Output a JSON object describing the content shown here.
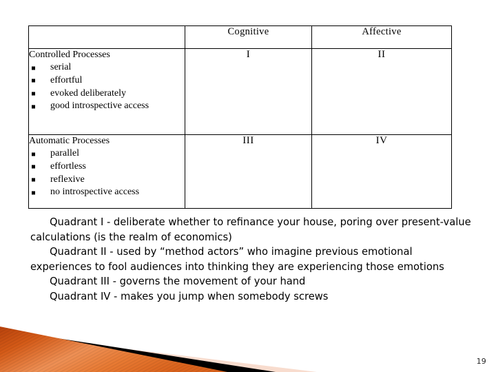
{
  "slide": {
    "page_number": "19"
  },
  "table": {
    "headers": {
      "blank": "",
      "cognitive": "Cognitive",
      "affective": "Affective"
    },
    "rows": [
      {
        "title": "Controlled Processes",
        "bullets": [
          "serial",
          "effortful",
          "evoked deliberately",
          "good introspective access"
        ],
        "cognitive": "I",
        "affective": "II"
      },
      {
        "title": "Automatic Processes",
        "bullets": [
          "parallel",
          "effortless",
          "reflexive",
          "no introspective access"
        ],
        "cognitive": "III",
        "affective": "IV"
      }
    ]
  },
  "body": {
    "paragraphs": [
      "Quadrant I - deliberate whether to refinance your house, poring over present-value calculations (is the realm of economics)",
      "Quadrant II - used by “method actors” who imagine previous emotional experiences to fool audiences into thinking they are experiencing those emotions",
      "Quadrant III - governs the movement of your hand",
      "Quadrant IV - makes you jump when somebody screws"
    ]
  },
  "decoration": {
    "orange_dark": "#C4490F",
    "orange_light": "#F2A268",
    "orange_mid": "#E2701F",
    "black": "#000000",
    "peach": "#F8DCCE"
  }
}
